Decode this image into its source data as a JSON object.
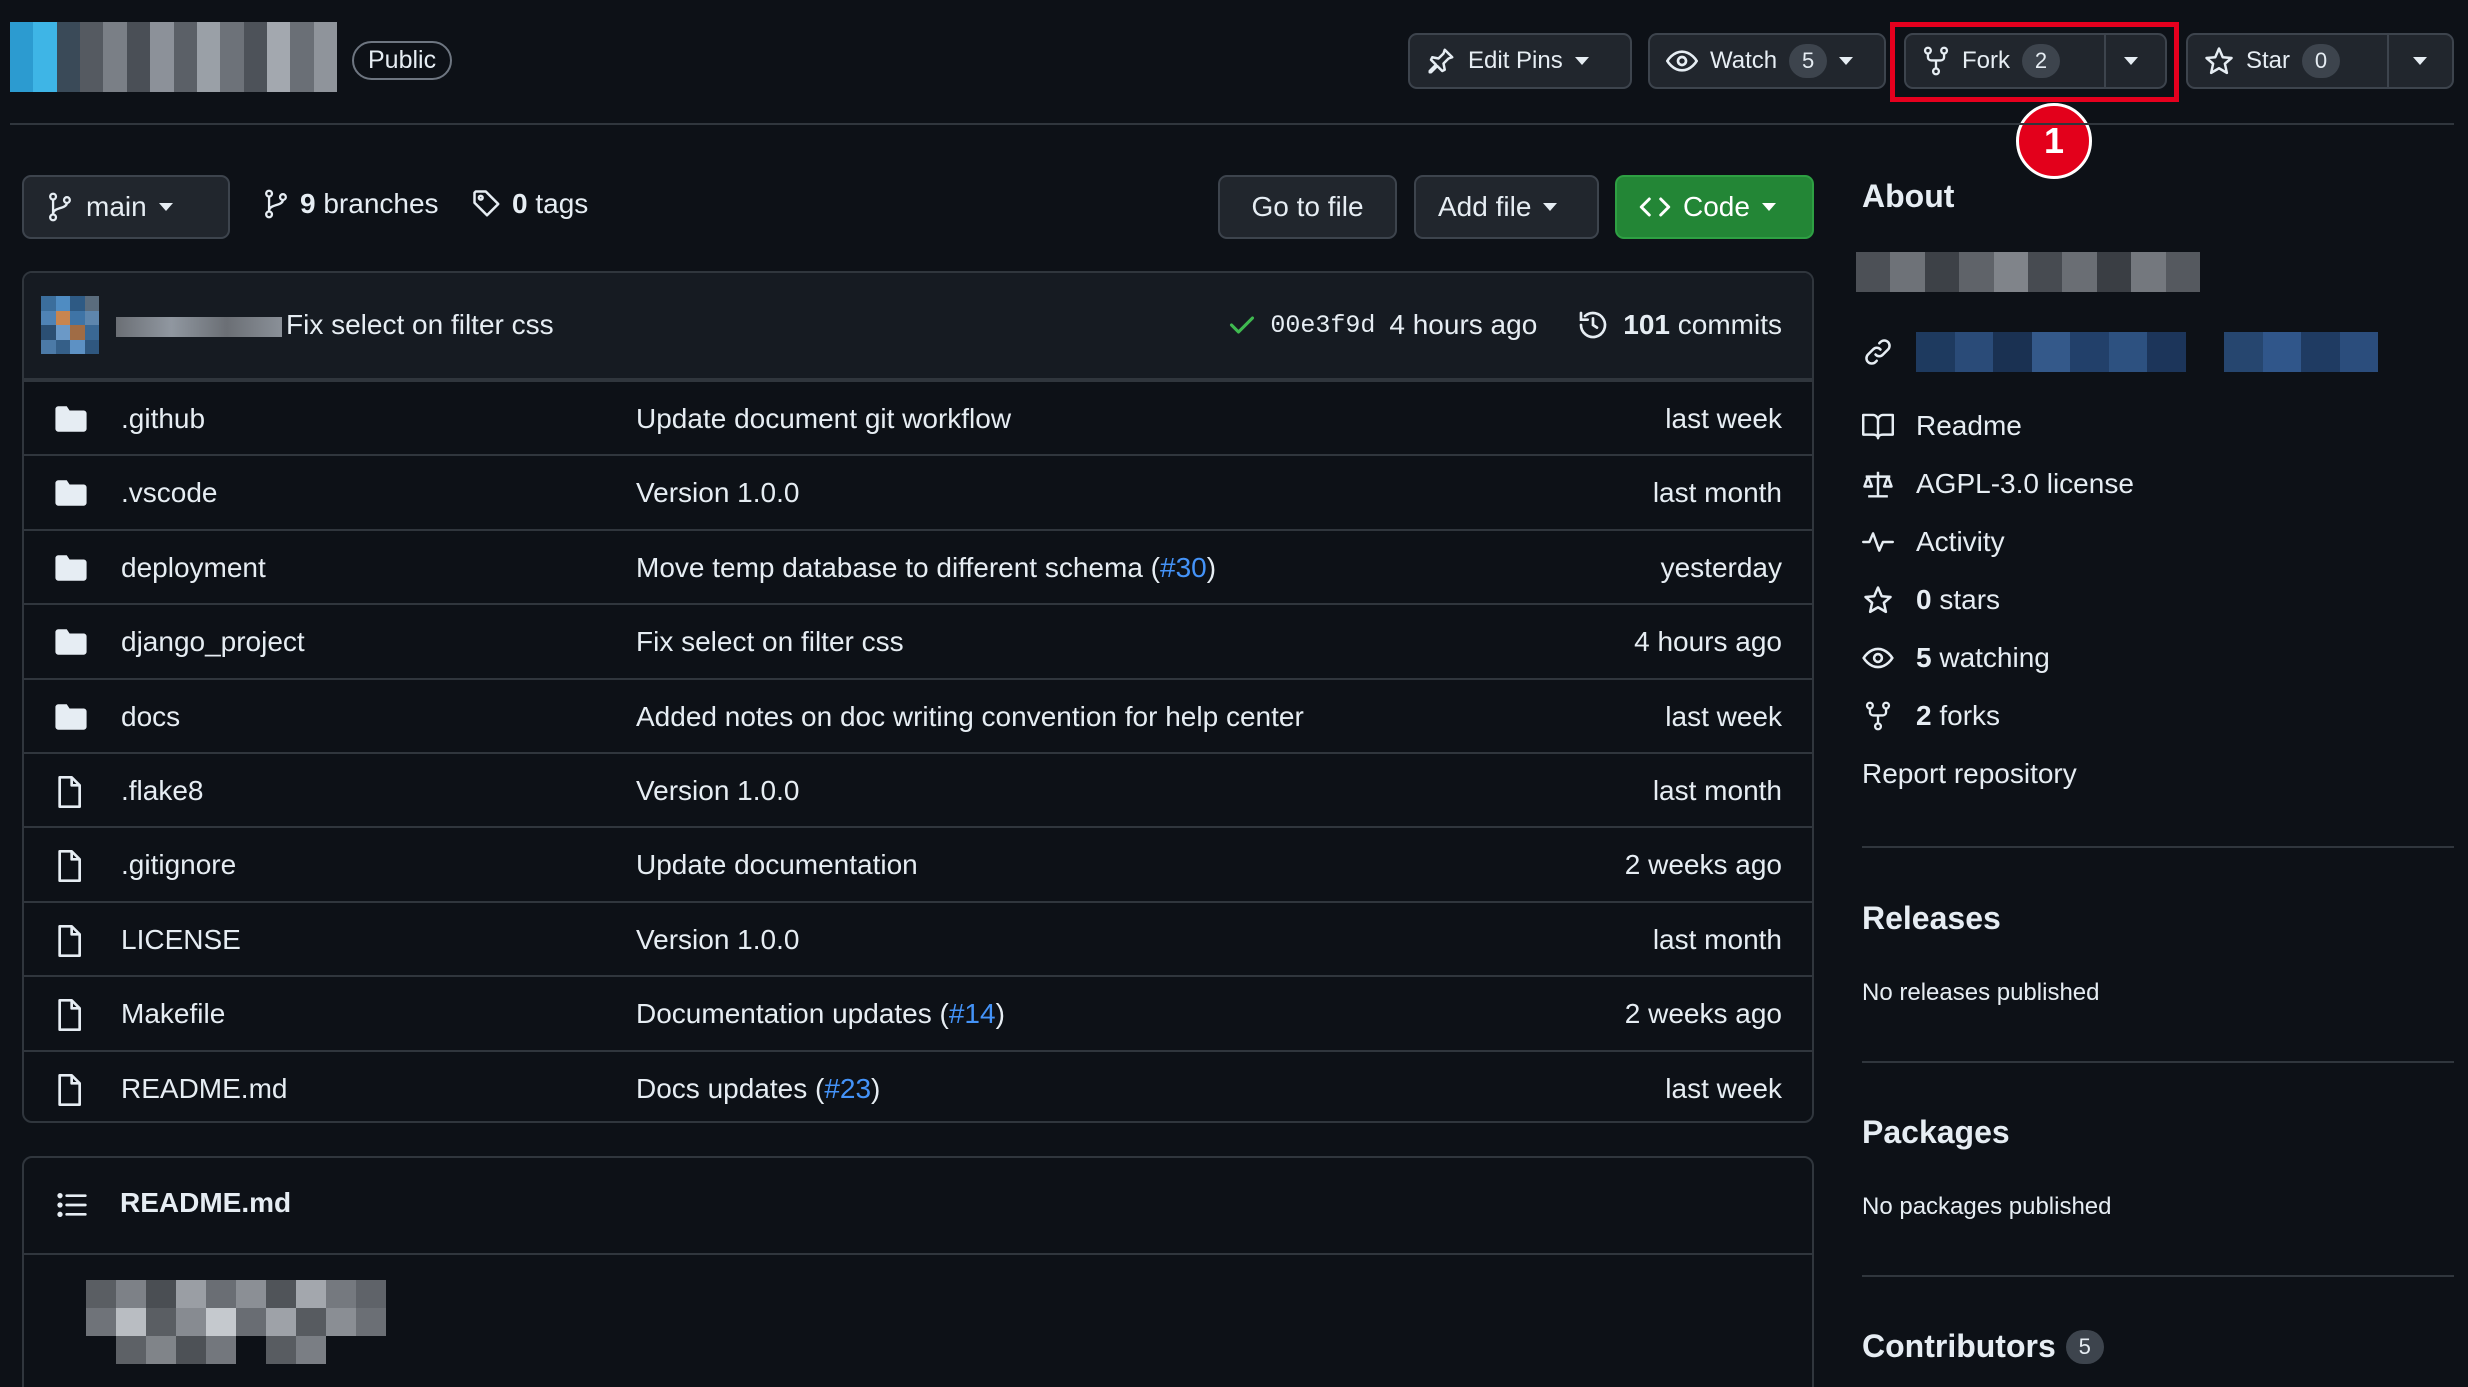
{
  "repo": {
    "visibility": "Public"
  },
  "header": {
    "edit_pins": "Edit Pins",
    "watch": {
      "label": "Watch",
      "count": "5"
    },
    "fork": {
      "label": "Fork",
      "count": "2"
    },
    "star": {
      "label": "Star",
      "count": "0"
    },
    "step_marker": "1"
  },
  "nav": {
    "branch": "main",
    "branches_count": "9",
    "branches_label": "branches",
    "tags_count": "0",
    "tags_label": "tags",
    "go_to_file": "Go to file",
    "add_file": "Add file",
    "code": "Code"
  },
  "latest_commit": {
    "message": "Fix select on filter css",
    "sha": "00e3f9d",
    "time": "4 hours ago",
    "commits_count": "101",
    "commits_label": "commits"
  },
  "files": [
    {
      "type": "dir",
      "name": ".github",
      "msg": "Update document git workflow",
      "pr": "",
      "msg_after": "",
      "age": "last week"
    },
    {
      "type": "dir",
      "name": ".vscode",
      "msg": "Version 1.0.0",
      "pr": "",
      "msg_after": "",
      "age": "last month"
    },
    {
      "type": "dir",
      "name": "deployment",
      "msg": "Move temp database to different schema (",
      "pr": "#30",
      "msg_after": ")",
      "age": "yesterday"
    },
    {
      "type": "dir",
      "name": "django_project",
      "msg": "Fix select on filter css",
      "pr": "",
      "msg_after": "",
      "age": "4 hours ago"
    },
    {
      "type": "dir",
      "name": "docs",
      "msg": "Added notes on doc writing convention for help center",
      "pr": "",
      "msg_after": "",
      "age": "last week"
    },
    {
      "type": "file",
      "name": ".flake8",
      "msg": "Version 1.0.0",
      "pr": "",
      "msg_after": "",
      "age": "last month"
    },
    {
      "type": "file",
      "name": ".gitignore",
      "msg": "Update documentation",
      "pr": "",
      "msg_after": "",
      "age": "2 weeks ago"
    },
    {
      "type": "file",
      "name": "LICENSE",
      "msg": "Version 1.0.0",
      "pr": "",
      "msg_after": "",
      "age": "last month"
    },
    {
      "type": "file",
      "name": "Makefile",
      "msg": "Documentation updates (",
      "pr": "#14",
      "msg_after": ")",
      "age": "2 weeks ago"
    },
    {
      "type": "file",
      "name": "README.md",
      "msg": "Docs updates (",
      "pr": "#23",
      "msg_after": ")",
      "age": "last week"
    }
  ],
  "readme": {
    "title": "README.md"
  },
  "sidebar": {
    "about_heading": "About",
    "readme": "Readme",
    "license": "AGPL-3.0 license",
    "activity": "Activity",
    "stars_count": "0",
    "stars_label": "stars",
    "watching_count": "5",
    "watching_label": "watching",
    "forks_count": "2",
    "forks_label": "forks",
    "report": "Report repository",
    "releases_heading": "Releases",
    "releases_note": "No releases published",
    "packages_heading": "Packages",
    "packages_note": "No packages published",
    "contributors_heading": "Contributors",
    "contributors_count": "5"
  },
  "colors": {
    "background": "#0d1117",
    "border": "#30363d",
    "code_button": "#238636",
    "link": "#4493f8",
    "highlight": "#e6001e"
  }
}
